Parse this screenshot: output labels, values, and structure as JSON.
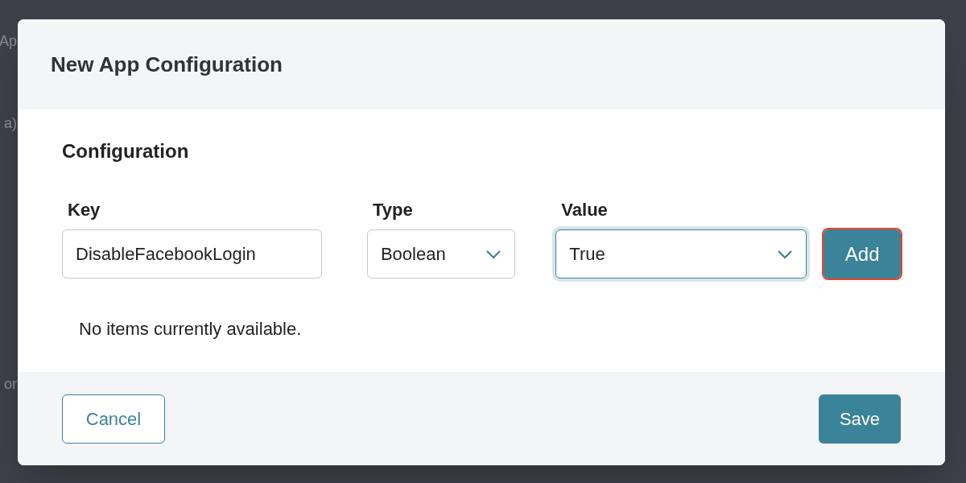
{
  "background_fragments": [
    "Ap",
    "a)",
    "or"
  ],
  "dialog": {
    "title": "New App Configuration",
    "section_title": "Configuration",
    "fields": [
      {
        "kind": "text",
        "label": "Key",
        "value": "DisableFacebookLogin",
        "focused": false
      },
      {
        "kind": "select",
        "label": "Type",
        "value": "Boolean",
        "focused": false
      },
      {
        "kind": "select",
        "label": "Value",
        "value": "True",
        "focused": true
      }
    ],
    "add_button": {
      "label": "Add",
      "highlighted": true
    },
    "empty_message": "No items currently available.",
    "cancel_button": "Cancel",
    "save_button": "Save"
  }
}
